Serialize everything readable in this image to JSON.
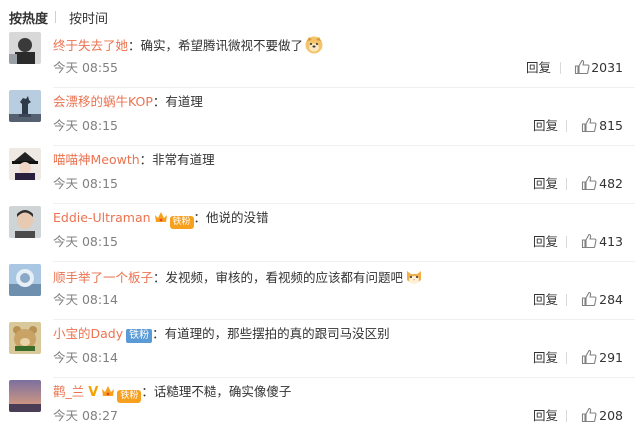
{
  "sort": {
    "hot_label": "按热度",
    "time_label": "按时间"
  },
  "colors": {
    "username": "#eb7350",
    "fan_badge": "#5a9bd6",
    "vip_badge": "#f7a01e"
  },
  "comments": [
    {
      "username": "终于失去了她",
      "text": "：确实，希望腾讯微视不要做了",
      "emoji": "doge-emoji",
      "time": "今天 08:55",
      "reply": "回复",
      "likes": "2031"
    },
    {
      "username": "会漂移的蜗牛KOP",
      "text": "：有道理",
      "time": "今天 08:15",
      "reply": "回复",
      "likes": "815"
    },
    {
      "username": "喵喵神Meowth",
      "text": "：非常有道理",
      "time": "今天 08:15",
      "reply": "回复",
      "likes": "482"
    },
    {
      "username": "Eddie-Ultraman",
      "badge": "铁粉",
      "text": "：他说的没错",
      "time": "今天 08:15",
      "reply": "回复",
      "likes": "413"
    },
    {
      "username": "顺手举了一个板子",
      "text": "：发视频，审核的，看视频的应该都有问题吧",
      "emoji": "cat-emoji",
      "time": "今天 08:14",
      "reply": "回复",
      "likes": "284"
    },
    {
      "username": "小宝的Dady",
      "badge": "铁粉",
      "text": "：有道理的，那些摆拍的真的跟司马没区别",
      "time": "今天 08:14",
      "reply": "回复",
      "likes": "291"
    },
    {
      "username": "鹳_兰",
      "badge": "铁粉",
      "text": "：话糙理不糙，确实像傻子",
      "time": "今天 08:27",
      "reply": "回复",
      "likes": "208"
    }
  ]
}
